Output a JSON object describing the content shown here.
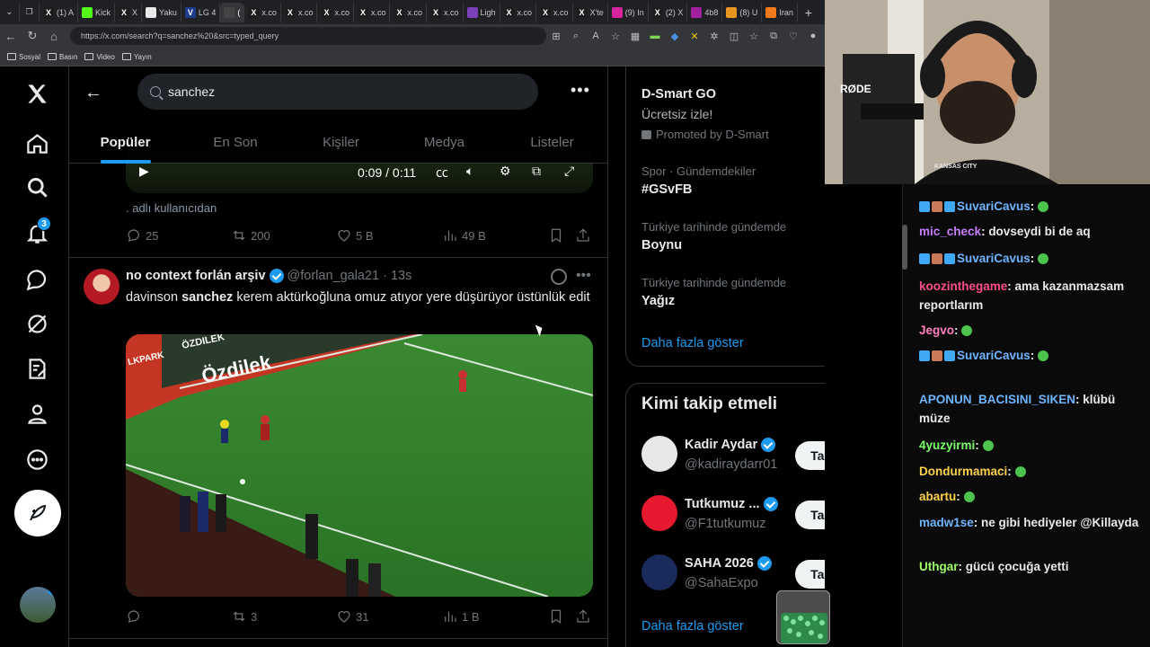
{
  "browser": {
    "tabs": [
      {
        "label": "(1) A",
        "color": "#1d1d1d",
        "glyph": "X"
      },
      {
        "label": "Kick",
        "color": "#53fc18",
        "glyph": ""
      },
      {
        "label": "X",
        "color": "#1d1d1d",
        "glyph": "X"
      },
      {
        "label": "Yaku",
        "color": "#e8e8e8",
        "glyph": ""
      },
      {
        "label": "LG 4",
        "color": "#1f3d8c",
        "glyph": "V"
      },
      {
        "label": "(",
        "color": "#444",
        "glyph": ""
      },
      {
        "label": "x.co",
        "color": "#1d1d1d",
        "glyph": "X"
      },
      {
        "label": "x.co",
        "color": "#1d1d1d",
        "glyph": "X"
      },
      {
        "label": "x.co",
        "color": "#1d1d1d",
        "glyph": "X"
      },
      {
        "label": "x.co",
        "color": "#1d1d1d",
        "glyph": "X"
      },
      {
        "label": "x.co",
        "color": "#1d1d1d",
        "glyph": "X"
      },
      {
        "label": "x.co",
        "color": "#1d1d1d",
        "glyph": "X"
      },
      {
        "label": "Ligh",
        "color": "#7b3fb8",
        "glyph": ""
      },
      {
        "label": "x.co",
        "color": "#1d1d1d",
        "glyph": "X"
      },
      {
        "label": "x.co",
        "color": "#1d1d1d",
        "glyph": "X"
      },
      {
        "label": "X'te",
        "color": "#1d1d1d",
        "glyph": "X"
      },
      {
        "label": "(9) In",
        "color": "#d6249f",
        "glyph": ""
      },
      {
        "label": "(2) X",
        "color": "#1d1d1d",
        "glyph": "X"
      },
      {
        "label": "4b8",
        "color": "#a020a0",
        "glyph": ""
      },
      {
        "label": "(8) U",
        "color": "#e89520",
        "glyph": ""
      },
      {
        "label": "Iran",
        "color": "#f27a1a",
        "glyph": ""
      }
    ],
    "new_tab": "+",
    "url": "https://x.com/search?q=sanchez%20&src=typed_query",
    "bookmarks": [
      "Sosyal",
      "Basın",
      "Video",
      "Yayın"
    ]
  },
  "nav": {
    "notifications_badge": "3"
  },
  "search": {
    "query": "sanchez",
    "tabs": [
      "Popüler",
      "En Son",
      "Kişiler",
      "Medya",
      "Listeler"
    ]
  },
  "tweet1": {
    "time": "0:09 / 0:11",
    "caption": ". adlı kullanıcıdan",
    "replies": "25",
    "reposts": "200",
    "likes": "5 B",
    "views": "49 B"
  },
  "tweet2": {
    "name": "no context forlán arşiv",
    "handle": "@forlan_gala21",
    "time": "· 13s",
    "text_pre": "davinson ",
    "text_bold": "sanchez",
    "text_post": " kerem aktürkoğluna omuz atıyor yere düşürüyor üstünlük edit",
    "ad_board": "Özdilek",
    "ad_board_left": "ÖZDILEK",
    "ad_board_side": "LKPARK",
    "replies": "",
    "reposts": "3",
    "likes": "31",
    "views": "1 B"
  },
  "sidebar": {
    "ad": {
      "title": "D-Smart GO",
      "subtitle": "Ücretsiz izle!",
      "promoted": "Promoted by D-Smart"
    },
    "trends": [
      {
        "meta": "Spor · Gündemdekiler",
        "name": "#GSvFB"
      },
      {
        "meta": "Türkiye tarihinde gündemde",
        "name": "Boynu"
      },
      {
        "meta": "Türkiye tarihinde gündemde",
        "name": "Yağız"
      }
    ],
    "show_more": "Daha fazla göster",
    "who_to_follow_title": "Kimi takip etmeli",
    "who_to_follow": [
      {
        "name": "Kadir Aydar",
        "handle": "@kadiraydarr01",
        "button": "Takip et",
        "color": "#e8e8e8"
      },
      {
        "name": "Tutkumuz ...",
        "handle": "@F1tutkumuz",
        "button": "Takip et",
        "color": "#e6192e"
      },
      {
        "name": "SAHA 2026",
        "handle": "@SahaExpo",
        "button": "Takip et",
        "color": "#1a2a5a"
      }
    ],
    "show_more_2": "Daha fazla göster"
  },
  "webcam": {
    "mic_brand": "RØDE",
    "shirt_text": "KANSAS CITY"
  },
  "chat": [
    {
      "user": "SuvariCavus",
      "color": "#6fb4ff",
      "message": "",
      "badges": true
    },
    {
      "user": "mic_check",
      "color": "#c77dff",
      "message": "dovseydi bi de aq",
      "badges": false
    },
    {
      "user": "SuvariCavus",
      "color": "#6fb4ff",
      "message": "",
      "badges": true
    },
    {
      "user": "koozinthegame",
      "color": "#ff4f8b",
      "message": "ama kazanmazsam reportlarım",
      "badges": false
    },
    {
      "user": "Jegvo",
      "color": "#ff7fbf",
      "message": "",
      "badges": false
    },
    {
      "user": "SuvariCavus",
      "color": "#6fb4ff",
      "message": "",
      "badges": true
    },
    {
      "user": "APONUN_BACISINI_SIKEN",
      "color": "#6fb4ff",
      "message": "klübü müze",
      "badges": false
    },
    {
      "user": "4yuzyirmi",
      "color": "#7cff6b",
      "message": "",
      "badges": false
    },
    {
      "user": "Dondurmamaci",
      "color": "#ffd24a",
      "message": "",
      "badges": false
    },
    {
      "user": "abartu",
      "color": "#ffd24a",
      "message": "",
      "badges": false
    },
    {
      "user": "madw1se",
      "color": "#6fb4ff",
      "message": "ne gibi hediyeler @Killayda",
      "badges": false
    },
    {
      "user": "Uthgar",
      "color": "#9cff6b",
      "message": "gücü çocuğa yetti",
      "badges": false
    }
  ]
}
